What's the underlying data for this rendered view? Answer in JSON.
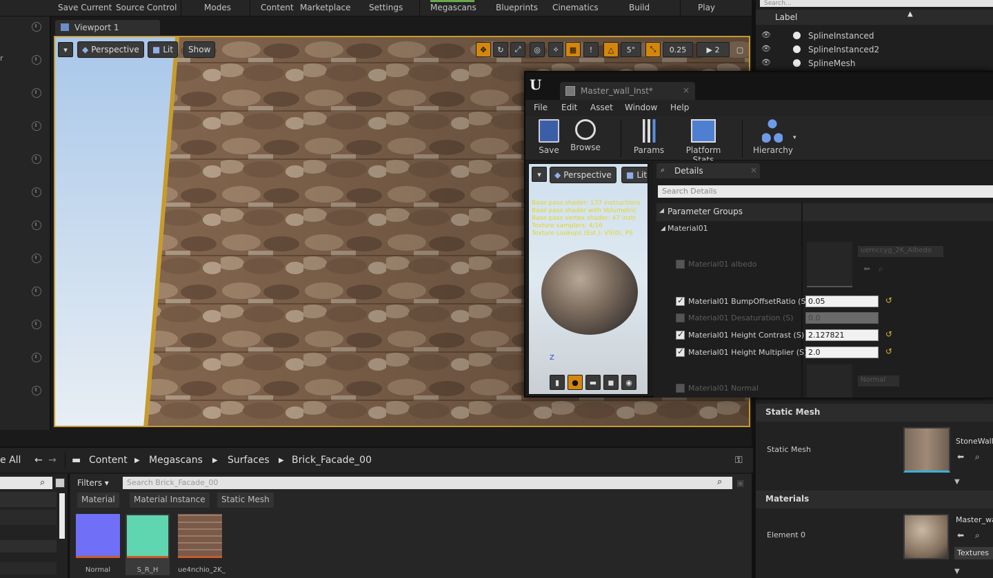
{
  "toolbar": {
    "items": [
      "Save Current",
      "Source Control",
      "Modes",
      "Content",
      "Marketplace",
      "Settings",
      "Megascans",
      "Blueprints",
      "Cinematics",
      "Build",
      "Play"
    ]
  },
  "viewport": {
    "tab_label": "Viewport 1",
    "perspective_label": "Perspective",
    "lit_label": "Lit",
    "show_label": "Show",
    "snap_scale": "0.25",
    "snap_rot": "5°",
    "camera_speed": "2"
  },
  "outliner": {
    "search_placeholder": "Search...",
    "label_header": "Label",
    "items": [
      "SplineInstanced",
      "SplineInstanced2",
      "SplineMesh"
    ]
  },
  "material_editor": {
    "tab_label": "Master_wall_Inst*",
    "menu": [
      "File",
      "Edit",
      "Asset",
      "Window",
      "Help"
    ],
    "tools": {
      "save": "Save",
      "browse": "Browse",
      "params": "Params",
      "platform_stats": "Platform Stats",
      "hierarchy": "Hierarchy"
    },
    "preview_perspective": "Perspective",
    "preview_lit": "Lit",
    "stats_text": [
      "Base pass shader: 137 instructions",
      "Base pass shader with Volumetric",
      "Base pass vertex shader: 47 instr",
      "Texture samplers: 4/16",
      "Texture Lookups (Est.): VS(0), PS"
    ],
    "details_tab": "Details",
    "search_placeholder": "Search Details",
    "parameter_groups": "Parameter Groups",
    "group_name": "Material01",
    "albedo_label": "Material01 albedo",
    "albedo_texture": "uemccyg_2K_Albedo",
    "params": [
      {
        "label": "Material01 BumpOffsetRatio (S)",
        "value": "0.05",
        "checked": true
      },
      {
        "label": "Material01 Desaturation (S)",
        "value": "0.0",
        "checked": false
      },
      {
        "label": "Material01 Height Contrast (S)",
        "value": "2.127821",
        "checked": true
      },
      {
        "label": "Material01 Height Multiplier (S)",
        "value": "2.0",
        "checked": true
      }
    ],
    "normal_label": "Material01 Normal",
    "normal_texture": "Normal"
  },
  "details_panel": {
    "static_mesh_header": "Static Mesh",
    "static_mesh_label": "Static Mesh",
    "static_mesh_value": "StoneWall",
    "materials_header": "Materials",
    "element_label": "Element 0",
    "element_value": "Master_wa",
    "textures_label": "Textures"
  },
  "content_browser": {
    "save_all": "e All",
    "breadcrumbs": [
      "Content",
      "Megascans",
      "Surfaces",
      "Brick_Facade_00"
    ],
    "filters_label": "Filters",
    "search_placeholder": "Search Brick_Facade_00",
    "filter_chips": [
      "Material",
      "Material Instance",
      "Static Mesh"
    ],
    "assets": [
      {
        "label": "Normal",
        "color": "#6f6ff7"
      },
      {
        "label": "S_R_H",
        "color": "#5fd6b0"
      },
      {
        "label": "ue4nchio_2K_",
        "color": "#7a5a48"
      }
    ]
  }
}
